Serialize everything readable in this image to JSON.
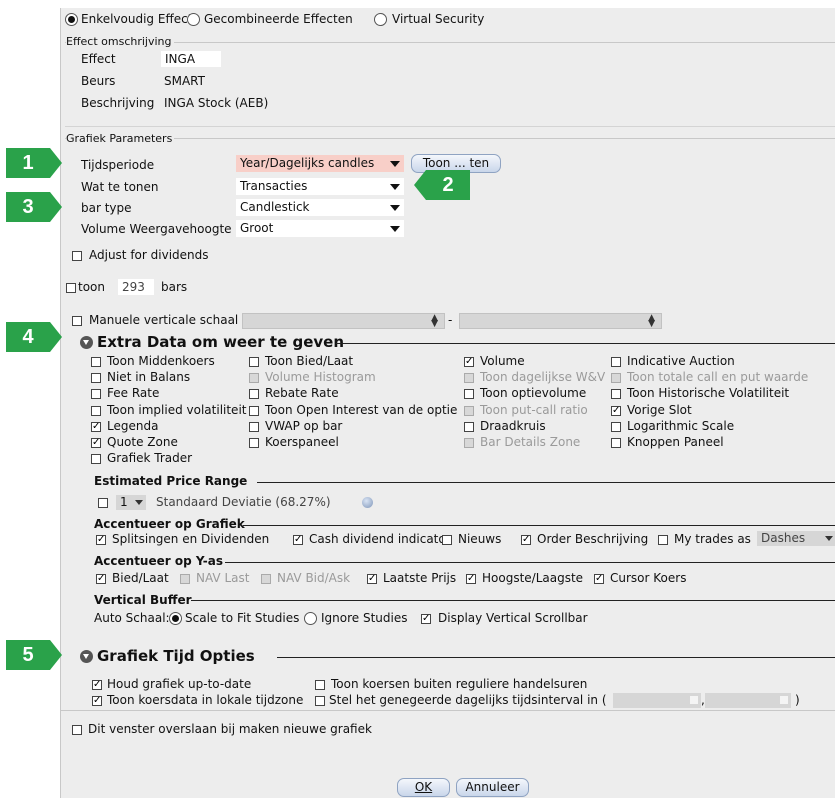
{
  "security_type": {
    "options": [
      "Enkelvoudig Effect",
      "Gecombineerde Effecten",
      "Virtual Security"
    ],
    "selected": "Enkelvoudig Effect"
  },
  "effect_desc": {
    "legend": "Effect omschrijving",
    "effect_label": "Effect",
    "effect_value": "INGA",
    "exchange_label": "Beurs",
    "exchange_value": "SMART",
    "description_label": "Beschrijving",
    "description_value": "INGA Stock (AEB)"
  },
  "params": {
    "legend": "Grafiek Parameters",
    "period_label": "Tijdsperiode",
    "period_value": "Year/Dagelijks candles",
    "period_button": "Toon ... ten",
    "show_label": "Wat te tonen",
    "show_value": "Transacties",
    "bartype_label": "bar type",
    "bartype_value": "Candlestick",
    "volheight_label": "Volume Weergavehoogte",
    "volheight_value": "Groot",
    "adjust_label": "Adjust for dividends",
    "toon_label": "toon",
    "toon_value": "293",
    "bars_label": "bars",
    "manual_scale_label": "Manuele verticale schaal",
    "manual_scale_sep": "-"
  },
  "extra": {
    "title": "Extra Data om weer te geven",
    "col1": [
      {
        "label": "Toon Middenkoers",
        "checked": false
      },
      {
        "label": "Niet in Balans",
        "checked": false
      },
      {
        "label": "Fee Rate",
        "checked": false
      },
      {
        "label": "Toon implied volatiliteit",
        "checked": false
      },
      {
        "label": "Legenda",
        "checked": true
      },
      {
        "label": "Quote Zone",
        "checked": true
      },
      {
        "label": "Grafiek Trader",
        "checked": false
      }
    ],
    "col2": [
      {
        "label": "Toon Bied/Laat",
        "checked": false
      },
      {
        "label": "Volume Histogram",
        "checked": false,
        "disabled": true
      },
      {
        "label": "Rebate Rate",
        "checked": false
      },
      {
        "label": "Toon Open Interest van de optie",
        "checked": false
      },
      {
        "label": "VWAP op bar",
        "checked": false
      },
      {
        "label": "Koerspaneel",
        "checked": false
      }
    ],
    "col3": [
      {
        "label": "Volume",
        "checked": true
      },
      {
        "label": "Toon dagelijkse W&V",
        "checked": false,
        "disabled": true
      },
      {
        "label": "Toon optievolume",
        "checked": false
      },
      {
        "label": "Toon put-call ratio",
        "checked": false,
        "disabled": true
      },
      {
        "label": "Draadkruis",
        "checked": false
      },
      {
        "label": "Bar Details Zone",
        "checked": false,
        "disabled": true
      }
    ],
    "col4": [
      {
        "label": "Indicative Auction",
        "checked": false
      },
      {
        "label": "Toon totale call en put waarde",
        "checked": false,
        "disabled": true
      },
      {
        "label": "Toon Historische Volatiliteit",
        "checked": false
      },
      {
        "label": "Vorige Slot",
        "checked": true
      },
      {
        "label": "Logarithmic Scale",
        "checked": false
      },
      {
        "label": "Knoppen Paneel",
        "checked": false
      }
    ]
  },
  "epr": {
    "title": "Estimated Price Range",
    "num_value": "1",
    "deviation_label": "Standaard Deviatie (68.27%)"
  },
  "accent_chart": {
    "title": "Accentueer op Grafiek",
    "items": [
      {
        "label": "Splitsingen en Dividenden",
        "checked": true
      },
      {
        "label": "Cash dividend indicator",
        "checked": true
      },
      {
        "label": "Nieuws",
        "checked": false
      },
      {
        "label": "Order Beschrijving",
        "checked": true
      },
      {
        "label": "My trades as",
        "checked": false
      }
    ],
    "trades_style": "Dashes"
  },
  "accent_y": {
    "title": "Accentueer op Y-as",
    "items": [
      {
        "label": "Bied/Laat",
        "checked": true
      },
      {
        "label": "NAV Last",
        "checked": false,
        "disabled": true
      },
      {
        "label": "NAV Bid/Ask",
        "checked": false,
        "disabled": true
      },
      {
        "label": "Laatste Prijs",
        "checked": true
      },
      {
        "label": "Hoogste/Laagste",
        "checked": true
      },
      {
        "label": "Cursor Koers",
        "checked": true
      }
    ]
  },
  "vbuffer": {
    "title": "Vertical Buffer",
    "autoscale_label": "Auto Schaal:",
    "opt1": "Scale to Fit Studies",
    "opt2": "Ignore Studies",
    "scrollbar_label": "Display Vertical Scrollbar",
    "scrollbar_checked": true
  },
  "time_opts": {
    "title": "Grafiek Tijd Opties",
    "keep_uptodate": "Houd grafiek up-to-date",
    "local_tz": "Toon koersdata in lokale tijdzone",
    "outside_hours": "Toon koersen buiten reguliere handelsuren",
    "interval_prefix": "Stel het genegeerde dagelijks tijdsinterval in (",
    "interval_comma": ",",
    "interval_suffix": ")"
  },
  "skip_label": "Dit venster overslaan bij maken nieuwe grafiek",
  "buttons": {
    "ok": "OK",
    "cancel": "Annuleer"
  },
  "callouts": [
    "1",
    "2",
    "3",
    "4",
    "5"
  ],
  "colors": {
    "callout": "#2aa24a",
    "highlight_combo": "#f8cfc8",
    "dialog_bg": "#ededed"
  }
}
